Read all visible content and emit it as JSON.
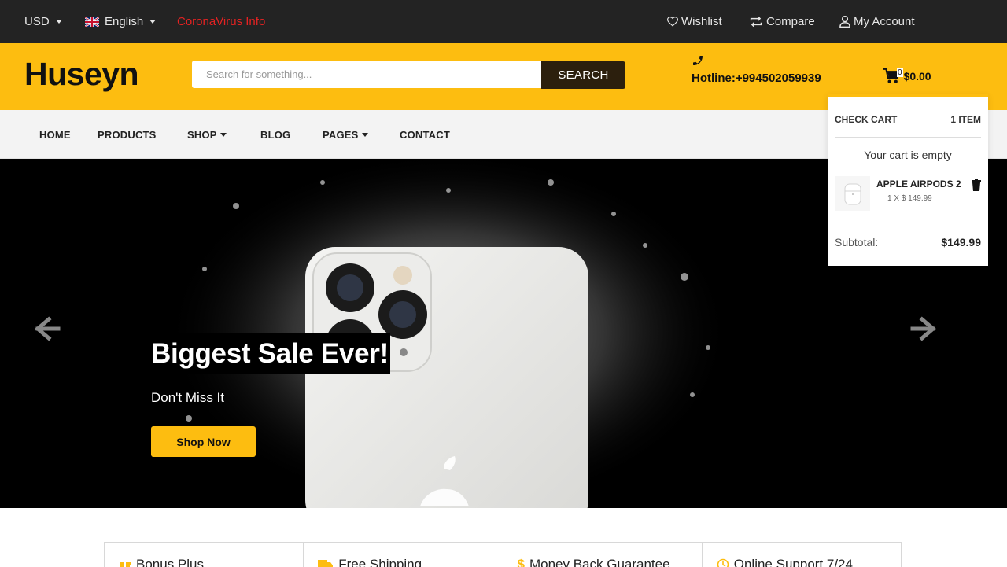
{
  "topbar": {
    "currency": "USD",
    "language": "English",
    "notice": "CoronaVirus Info",
    "wishlist": "Wishlist",
    "compare": "Compare",
    "account": "My Account"
  },
  "header": {
    "logo": "Huseyn",
    "search_placeholder": "Search for something...",
    "search_button": "SEARCH",
    "hotline": "Hotline:+994502059939",
    "cart_count": "0",
    "cart_total": "$0.00"
  },
  "nav": {
    "home": "HOME",
    "products": "PRODUCTS",
    "shop": "SHOP",
    "blog": "BLOG",
    "pages": "PAGES",
    "contact": "CONTACT"
  },
  "hero": {
    "title": "Biggest Sale Ever!",
    "subtitle": "Don't Miss It",
    "button": "Shop Now"
  },
  "cart_dropdown": {
    "heading": "CHECK CART",
    "items_count": "1 ITEM",
    "empty_message": "Your cart is empty",
    "product_name": "APPLE AIRPODS 2",
    "product_qty": "1 X $ 149.99",
    "subtotal_label": "Subtotal:",
    "subtotal_value": "$149.99"
  },
  "features": [
    {
      "label": "Bonus Plus",
      "icon": "gift-icon"
    },
    {
      "label": "Free Shipping",
      "icon": "truck-icon"
    },
    {
      "label": "Money Back Guarantee",
      "icon": "dollar-icon"
    },
    {
      "label": "Online Support 7/24",
      "icon": "clock-icon"
    }
  ],
  "colors": {
    "brand_yellow": "#fdbd10",
    "topbar_dark": "#232323",
    "search_button": "#2c1f0d",
    "notice_red": "#e52222"
  }
}
